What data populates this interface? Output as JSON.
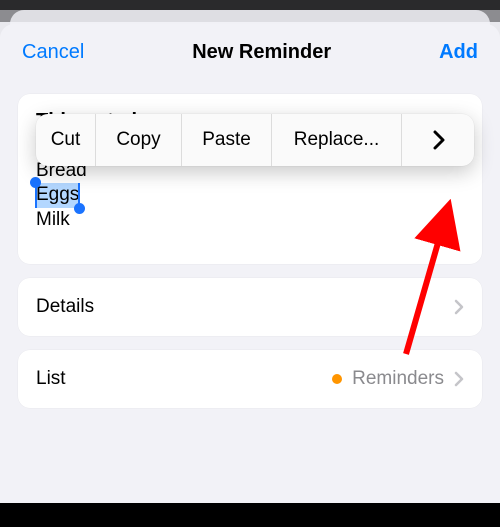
{
  "nav": {
    "cancel": "Cancel",
    "title": "New Reminder",
    "add": "Add"
  },
  "note": {
    "title": "Things to buy",
    "lines": [
      "Bread",
      "Eggs",
      "Milk"
    ],
    "selected_line_index": 1
  },
  "context_menu": {
    "cut": "Cut",
    "copy": "Copy",
    "paste": "Paste",
    "replace": "Replace..."
  },
  "rows": {
    "details": "Details",
    "list": "List",
    "list_value": "Reminders"
  },
  "colors": {
    "accent": "#007aff",
    "list_dot": "#ff9500"
  }
}
